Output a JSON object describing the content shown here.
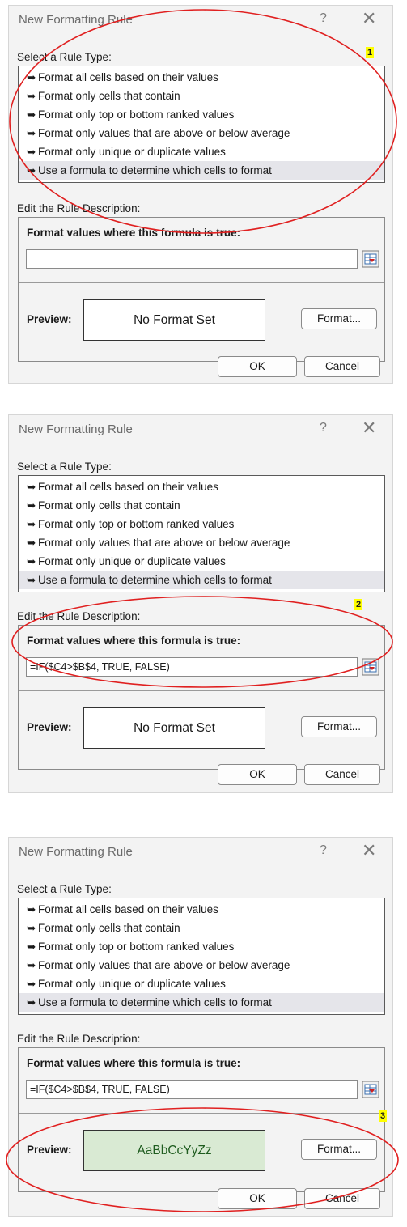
{
  "dialog": {
    "title": "New Formatting Rule",
    "help_glyph": "?",
    "close_glyph": "✕",
    "select_label": "Select a Rule Type:",
    "rule_types": [
      "Format all cells based on their values",
      "Format only cells that contain",
      "Format only top or bottom ranked values",
      "Format only values that are above or below average",
      "Format only unique or duplicate values",
      "Use a formula to determine which cells to format"
    ],
    "selected_index": 5,
    "edit_label": "Edit the Rule Description:",
    "formula_heading": "Format values where this formula is true:",
    "preview_label": "Preview:",
    "format_button": "Format...",
    "ok_button": "OK",
    "cancel_button": "Cancel",
    "bullet_glyph": "➥",
    "ref_icon": "collapse-dialog-icon"
  },
  "steps": [
    {
      "badge": "1",
      "formula_value": "",
      "preview_text": "No Format Set",
      "preview_bg": "#ffffff",
      "preview_color": "#1a1a1a"
    },
    {
      "badge": "2",
      "formula_value": "=IF($C4>$B$4, TRUE, FALSE)",
      "preview_text": "No Format Set",
      "preview_bg": "#ffffff",
      "preview_color": "#1a1a1a"
    },
    {
      "badge": "3",
      "formula_value": "=IF($C4>$B$4, TRUE, FALSE)",
      "preview_text": "AaBbCcYyZz",
      "preview_bg": "#d9ead3",
      "preview_color": "#1f5c1f"
    }
  ],
  "colors": {
    "annotation": "#e02020",
    "badge": "#ffff00",
    "selected_row": "#e5e5ea"
  }
}
